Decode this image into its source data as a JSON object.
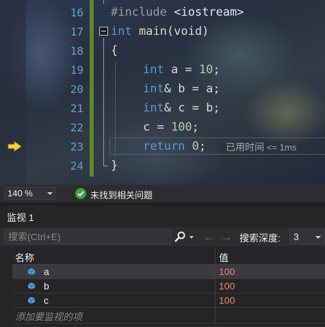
{
  "editor": {
    "line_numbers": [
      "16",
      "17",
      "18",
      "19",
      "20",
      "21",
      "22",
      "23",
      "24"
    ],
    "lines": {
      "l16": {
        "a": "#include ",
        "b": "<iostream>"
      },
      "l17": {
        "kw": "int",
        "fn": "main",
        "rest": "(void)"
      },
      "l18": {
        "text": "{"
      },
      "l19": {
        "kw": "int",
        "rest": " a = ",
        "num": "10",
        "end": ";"
      },
      "l20": {
        "kw": "int",
        "rest": "& b = a;"
      },
      "l21": {
        "kw": "int",
        "rest": "& c = b;"
      },
      "l22": {
        "rest": "c = ",
        "num": "100",
        "end": ";"
      },
      "l23": {
        "kw": "return",
        "rest": " ",
        "num": "0",
        "end": ";"
      },
      "l24": {
        "text": "}"
      }
    },
    "perf_tip": {
      "label": "已用时间",
      "value": "<= 1ms"
    },
    "current_line_icon": "current-statement-arrow-icon"
  },
  "statusbar": {
    "zoom": "140 %",
    "issues_text": "未找到相关问题",
    "issues_icon": "check-circle-icon"
  },
  "watch": {
    "title": "监视 1",
    "search_placeholder": "搜索(Ctrl+E)",
    "depth_label": "搜索深度:",
    "depth_value": "3",
    "nav_back": "←",
    "nav_fwd": "→",
    "columns": {
      "name": "名称",
      "value": "值"
    },
    "rows": [
      {
        "name": "a",
        "value": "100"
      },
      {
        "name": "b",
        "value": "100"
      },
      {
        "name": "c",
        "value": "100"
      }
    ],
    "add_placeholder": "添加要监视的项"
  },
  "colors": {
    "keyword": "#569cd6",
    "function": "#dcdcaa",
    "number": "#b5cea8",
    "line_number": "#5aa6c9",
    "watch_value_changed": "#f48771",
    "change_bar": "#5b8a2a",
    "ok_green": "#3fa33f"
  }
}
